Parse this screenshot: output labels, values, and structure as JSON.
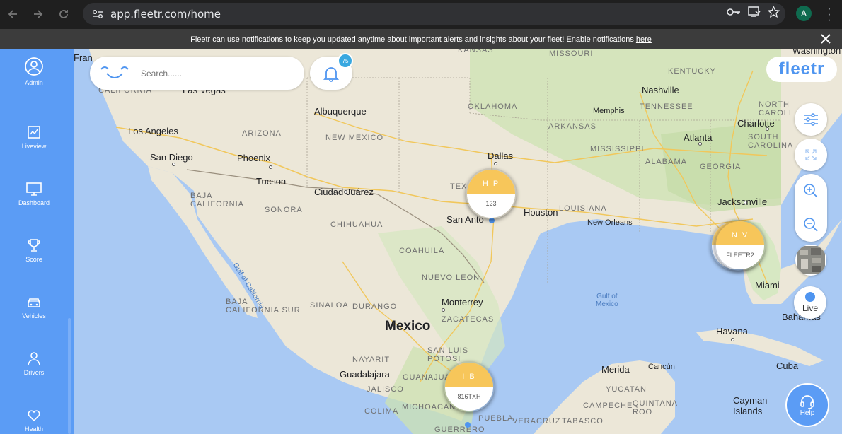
{
  "browser": {
    "url": "app.fleetr.com/home",
    "profile_initial": "A"
  },
  "notification": {
    "message": "Fleetr can use notifications to keep you updated anytime about important alerts and insights about your fleet! Enable notifications",
    "link": "here"
  },
  "sidebar": {
    "items": [
      {
        "label": "Admin",
        "icon": "user-circle-icon"
      },
      {
        "label": "Liveview",
        "icon": "map-icon"
      },
      {
        "label": "Dashboard",
        "icon": "monitor-icon"
      },
      {
        "label": "Score",
        "icon": "trophy-icon"
      },
      {
        "label": "Vehicles",
        "icon": "car-icon"
      },
      {
        "label": "Drivers",
        "icon": "driver-icon"
      },
      {
        "label": "Health",
        "icon": "health-icon"
      }
    ]
  },
  "search": {
    "placeholder": "Search......"
  },
  "notifications_badge": "75",
  "brand": "fleetr",
  "controls": {
    "live_label": "Live",
    "help_label": "Help"
  },
  "vehicles": [
    {
      "initials": "H P",
      "plate": "123"
    },
    {
      "initials": "N V",
      "plate": "FLEETR2"
    },
    {
      "initials": "I B",
      "plate": "816TXH"
    }
  ],
  "map_labels": {
    "cities": [
      "Las Vegas",
      "Albuquerque",
      "Los Angeles",
      "San Diego",
      "Phoenix",
      "Tucson",
      "Ciudad Juárez",
      "Dallas",
      "San Antonio",
      "Houston",
      "New Orleans",
      "Memphis",
      "Nashville",
      "Atlanta",
      "Charlotte",
      "Jacksonville",
      "Miami",
      "Havana",
      "Monterrey",
      "Mexico",
      "Guadalajara",
      "Merida",
      "Cancún",
      "Cuba",
      "Cayman Islands",
      "Bahamas",
      "Washington",
      "Fran"
    ],
    "states": [
      "CALIFORNIA",
      "ARIZONA",
      "NEW MEXICO",
      "OKLAHOMA",
      "ARKANSAS",
      "TENNESSEE",
      "KENTUCKY",
      "MISSOURI",
      "KANSAS",
      "MISSISSIPPI",
      "ALABAMA",
      "GEORGIA",
      "SOUTH CAROLINA",
      "NORTH CAROLINA",
      "LOUISIANA",
      "TEXAS",
      "BAJA CALIFORNIA",
      "SONORA",
      "CHIHUAHUA",
      "COAHUILA",
      "NUEVO LEON",
      "BAJA CALIFORNIA SUR",
      "SINALOA",
      "DURANGO",
      "ZACATECAS",
      "SAN LUIS POTOSI",
      "NAYARIT",
      "JALISCO",
      "GUANAJUATO",
      "COLIMA",
      "MICHOACAN",
      "PUEBLA",
      "VERACRUZ",
      "GUERRERO",
      "TABASCO",
      "YUCATAN",
      "CAMPECHE",
      "QUINTANA ROO"
    ],
    "water": [
      "Gulf of California",
      "Gulf of Mexico"
    ]
  }
}
